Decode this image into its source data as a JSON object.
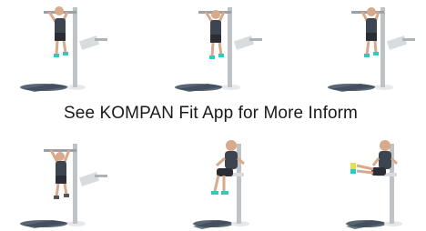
{
  "banner": {
    "text": "See KOMPAN Fit App for More Inform"
  },
  "colors": {
    "text": "#1a1a1a",
    "pole": "#bfc3c6",
    "shadow": "#3b4a5a",
    "skin": "#d8a98a",
    "shirt": "#3d4550",
    "shorts": "#2a2d33",
    "shoe": "#33c8b8"
  },
  "tiles": [
    {
      "icon": "pull-up-exercise-image"
    },
    {
      "icon": "pull-up-exercise-image"
    },
    {
      "icon": "pull-up-exercise-image"
    },
    {
      "icon": "hanging-exercise-image"
    },
    {
      "icon": "seated-dip-exercise-image"
    },
    {
      "icon": "leg-raise-exercise-image"
    }
  ]
}
